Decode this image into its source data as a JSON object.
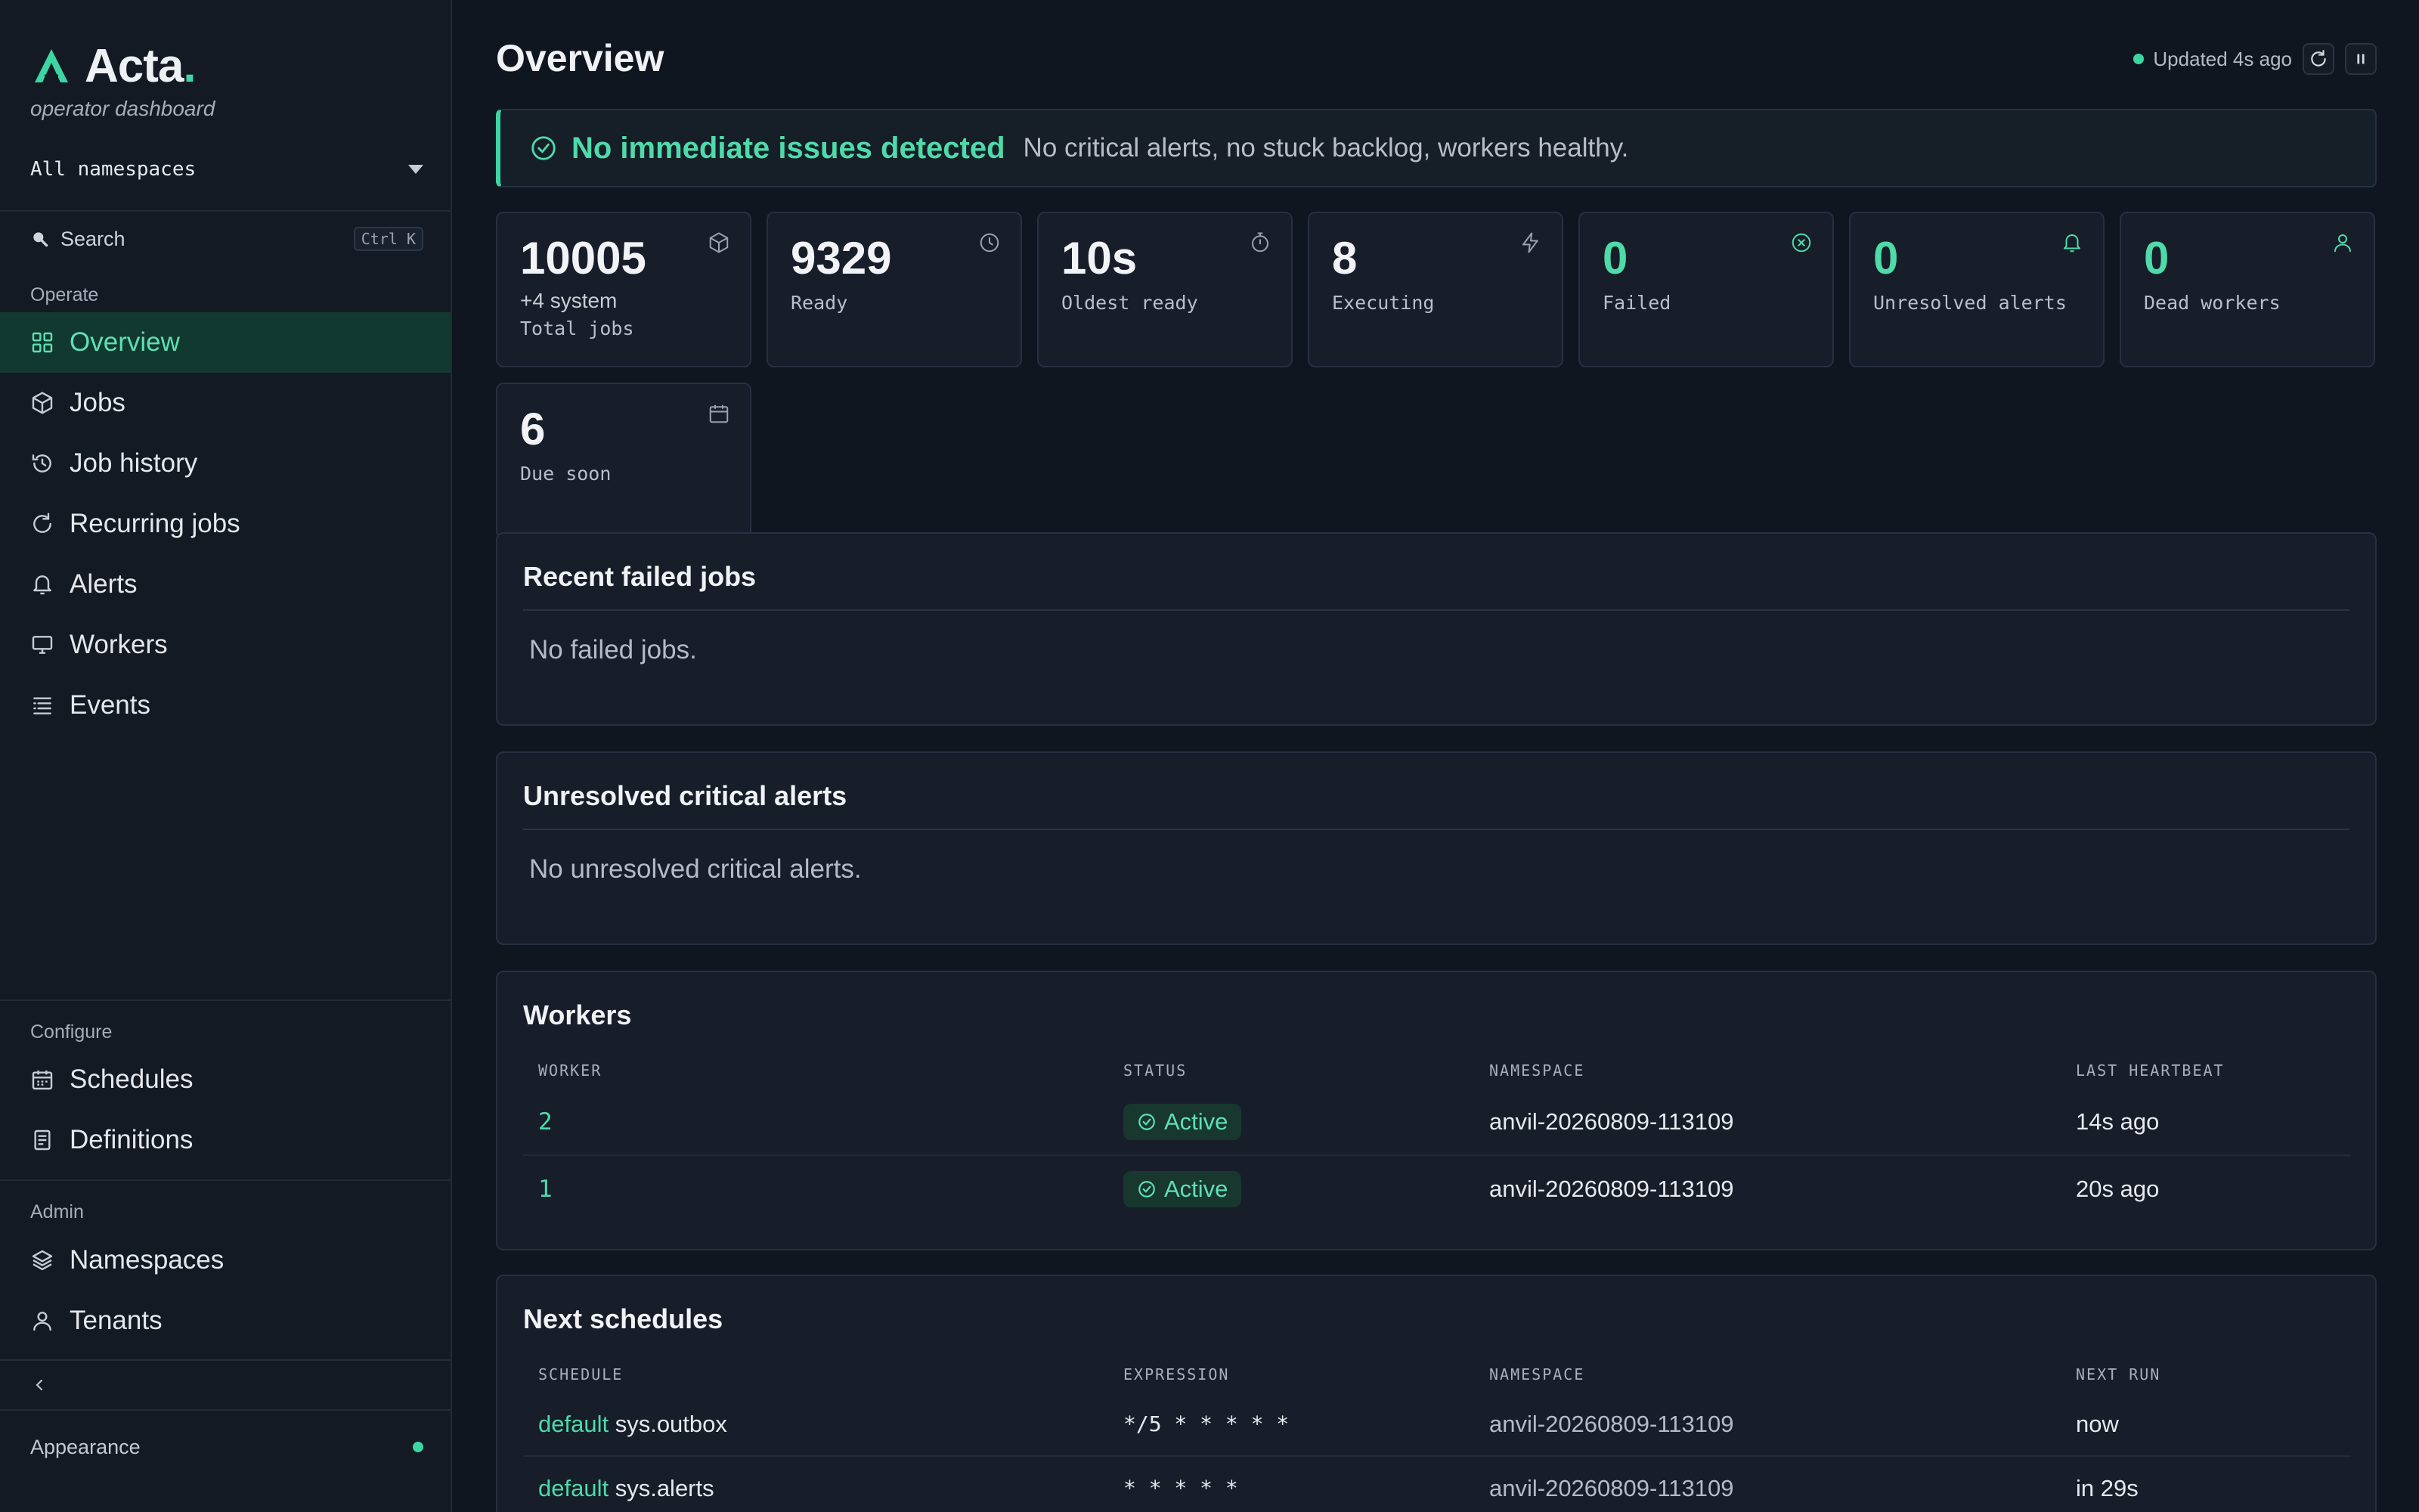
{
  "sidebar": {
    "brand_name": "Acta",
    "brand_dot": ".",
    "brand_subtitle": "operator dashboard",
    "namespace_select": "All namespaces",
    "search_label": "Search",
    "search_shortcut": "Ctrl K",
    "sections": {
      "operate": "Operate",
      "configure": "Configure",
      "admin": "Admin"
    },
    "items": [
      {
        "label": "Overview",
        "icon": "grid-icon",
        "active": true
      },
      {
        "label": "Jobs",
        "icon": "cube-icon"
      },
      {
        "label": "Job history",
        "icon": "history-icon"
      },
      {
        "label": "Recurring jobs",
        "icon": "refresh-icon"
      },
      {
        "label": "Alerts",
        "icon": "bell-icon"
      },
      {
        "label": "Workers",
        "icon": "monitor-icon"
      },
      {
        "label": "Events",
        "icon": "list-icon"
      },
      {
        "label": "Schedules",
        "icon": "calendar-icon"
      },
      {
        "label": "Definitions",
        "icon": "document-icon"
      },
      {
        "label": "Namespaces",
        "icon": "layers-icon"
      },
      {
        "label": "Tenants",
        "icon": "user-icon"
      }
    ],
    "appearance_label": "Appearance"
  },
  "header": {
    "title": "Overview",
    "updated": "Updated 4s ago"
  },
  "banner": {
    "title": "No immediate issues detected",
    "text": "No critical alerts, no stuck backlog, workers healthy."
  },
  "stats": [
    {
      "value": "10005",
      "sub": "+4 system",
      "label": "Total jobs",
      "icon": "cube-icon"
    },
    {
      "value": "9329",
      "label": "Ready",
      "icon": "clock-icon"
    },
    {
      "value": "10s",
      "label": "Oldest ready",
      "icon": "stopwatch-icon"
    },
    {
      "value": "8",
      "label": "Executing",
      "icon": "bolt-icon"
    },
    {
      "value": "0",
      "label": "Failed",
      "icon": "x-circle-icon"
    },
    {
      "value": "0",
      "label": "Unresolved alerts",
      "icon": "bell-icon"
    },
    {
      "value": "0",
      "label": "Dead workers",
      "icon": "user-icon"
    },
    {
      "value": "6",
      "label": "Due soon",
      "icon": "calendar-icon"
    }
  ],
  "failed_jobs": {
    "title": "Recent failed jobs",
    "empty": "No failed jobs."
  },
  "critical_alerts": {
    "title": "Unresolved critical alerts",
    "empty": "No unresolved critical alerts."
  },
  "workers": {
    "title": "Workers",
    "columns": [
      "WORKER",
      "STATUS",
      "NAMESPACE",
      "LAST HEARTBEAT"
    ],
    "rows": [
      {
        "worker": "2",
        "status": "Active",
        "namespace": "anvil-20260809-113109",
        "heartbeat": "14s ago"
      },
      {
        "worker": "1",
        "status": "Active",
        "namespace": "anvil-20260809-113109",
        "heartbeat": "20s ago"
      }
    ]
  },
  "schedules": {
    "title": "Next schedules",
    "columns": [
      "SCHEDULE",
      "EXPRESSION",
      "NAMESPACE",
      "NEXT RUN"
    ],
    "rows": [
      {
        "tenant": "default",
        "name": "sys.outbox",
        "expression": "*/5 * * * * *",
        "namespace": "anvil-20260809-113109",
        "next_run": "now"
      },
      {
        "tenant": "default",
        "name": "sys.alerts",
        "expression": "* * * * *",
        "namespace": "anvil-20260809-113109",
        "next_run": "in 29s"
      }
    ]
  },
  "colors": {
    "accent": "#3dd6a3",
    "background": "#101620",
    "panel": "#171e29"
  }
}
